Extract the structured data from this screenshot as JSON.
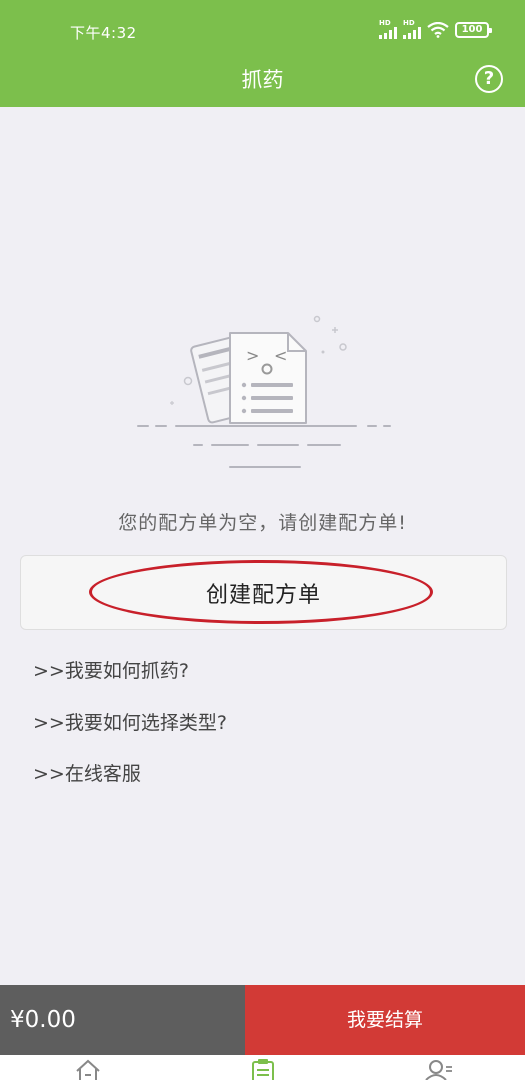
{
  "status_bar": {
    "time": "下午4:32",
    "signal1_label": "HD",
    "signal2_label": "HD",
    "battery": "100"
  },
  "header": {
    "title": "抓药",
    "help_icon": "question-circle-icon",
    "help_symbol": "?"
  },
  "empty_state": {
    "message": "您的配方单为空，请创建配方单!"
  },
  "create_button": {
    "label": "创建配方单"
  },
  "help_links": [
    ">>我要如何抓药?",
    ">>我要如何选择类型?",
    ">>在线客服"
  ],
  "bottom_bar": {
    "total": "¥0.00",
    "checkout_label": "我要结算"
  },
  "colors": {
    "header": "#7cbf4c",
    "checkout": "#d23a36",
    "total_bg": "#5e5e5e",
    "highlight_ellipse": "#c8202a"
  },
  "tabs": [
    {
      "icon": "home-icon"
    },
    {
      "icon": "clipboard-icon"
    },
    {
      "icon": "user-icon"
    }
  ]
}
